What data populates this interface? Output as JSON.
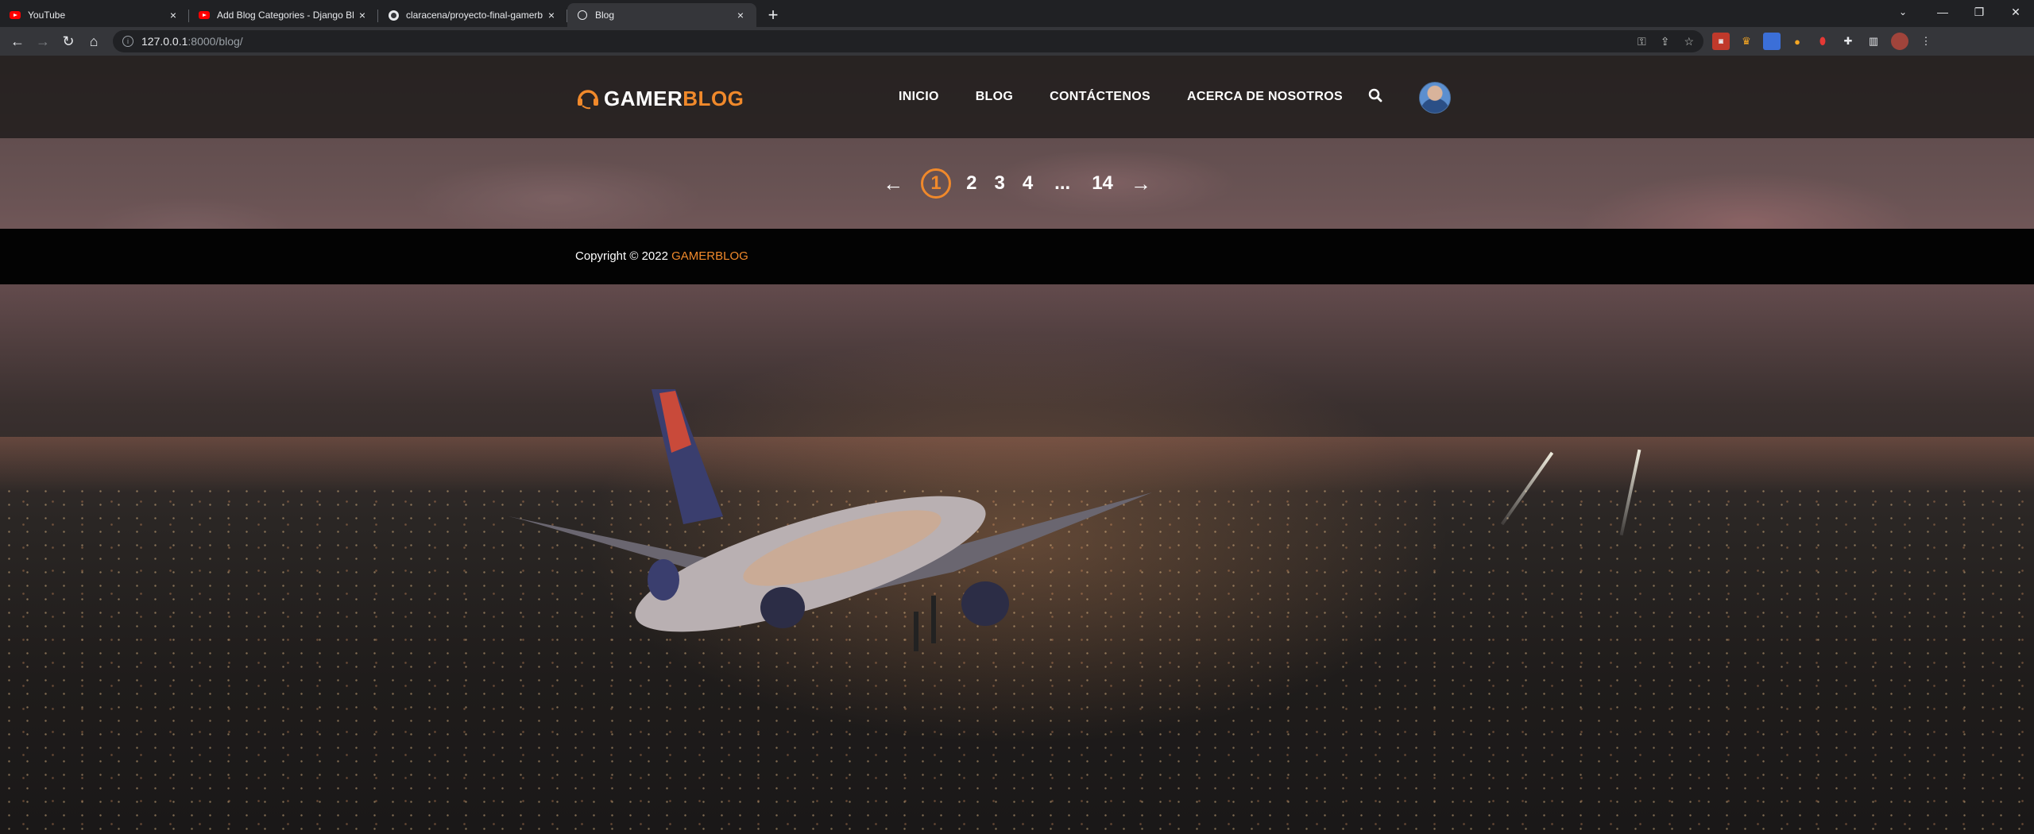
{
  "browser": {
    "tabs": [
      {
        "title": "YouTube",
        "icon": "youtube-icon",
        "active": false
      },
      {
        "title": "Add Blog Categories - Django Bl",
        "icon": "youtube-icon",
        "active": false
      },
      {
        "title": "claracena/proyecto-final-gamerb",
        "icon": "github-icon",
        "active": false
      },
      {
        "title": "Blog",
        "icon": "globe-icon",
        "active": true
      }
    ],
    "close_glyph": "×",
    "new_tab_glyph": "+",
    "url_host": "127.0.0.1",
    "url_path": ":8000/blog/",
    "window_controls": {
      "minimize": "—",
      "restore": "❐",
      "close": "✕"
    }
  },
  "site": {
    "logo": {
      "part1": "GAMER",
      "part2": "BLOG"
    },
    "nav": [
      {
        "label": "INICIO"
      },
      {
        "label": "BLOG"
      },
      {
        "label": "CONTÁCTENOS"
      },
      {
        "label": "ACERCA DE NOSOTROS"
      }
    ],
    "accent_color": "#f0892b"
  },
  "pagination": {
    "prev": "←",
    "pages": [
      "1",
      "2",
      "3",
      "4"
    ],
    "current": "1",
    "ellipsis": "...",
    "last": "14",
    "next": "→"
  },
  "footer": {
    "copyright": "Copyright © 2022",
    "brand": "GAMERBLOG"
  }
}
